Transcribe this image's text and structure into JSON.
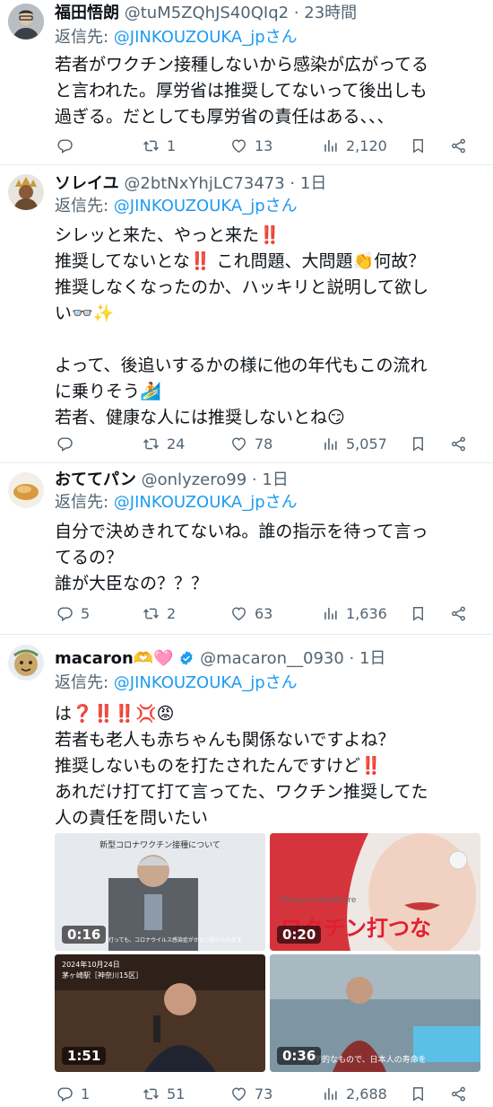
{
  "tweets": [
    {
      "name": "福田悟朗",
      "handle": "@tuM5ZQhJS40QIq2",
      "time": "23時間",
      "reply_prefix": "返信先: ",
      "reply_to": "@JINKOUZOUKA_jpさん",
      "lines": [
        "若者がワクチン接種しないから感染が広がってる",
        "と言われた。厚労省は推奨してないって後出しも",
        "過ぎる。だとしても厚労省の責任はある、、、"
      ],
      "replies": "",
      "retweets": "1",
      "likes": "13",
      "views": "2,120"
    },
    {
      "name": "ソレイユ",
      "handle": "@2btNxYhjLC73473",
      "time": "1日",
      "reply_prefix": "返信先: ",
      "reply_to": "@JINKOUZOUKA_jpさん",
      "lines": [
        "シレッと来た、やっと来た‼️",
        "推奨してないとな‼️ これ問題、大問題👏何故？",
        "推奨しなくなったのか、ハッキリと説明して欲し",
        "い👓✨",
        "",
        "よって、後追いするかの様に他の年代もこの流れ",
        "に乗りそう🏄",
        "若者、健康な人には推奨しないとね😏"
      ],
      "replies": "",
      "retweets": "24",
      "likes": "78",
      "views": "5,057"
    },
    {
      "name": "おててパン",
      "handle": "@onlyzero99",
      "time": "1日",
      "reply_prefix": "返信先: ",
      "reply_to": "@JINKOUZOUKA_jpさん",
      "lines": [
        "自分で決めきれてないね。誰の指示を待って言っ",
        "てるの？",
        "誰が大臣なの？？？"
      ],
      "replies": "5",
      "retweets": "2",
      "likes": "63",
      "views": "1,636"
    },
    {
      "name": "macaron🫶🩷",
      "handle": "@macaron__0930",
      "time": "1日",
      "reply_prefix": "返信先: ",
      "reply_to": "@JINKOUZOUKA_jpさん",
      "lines": [
        "は❓‼️‼️💢😡",
        "若者も老人も赤ちゃんも関係ないですよね？",
        "推奨しないものを打たされたんですけど‼️",
        "あれだけ打て打て言ってた、ワクチン推奨してた",
        "人の責任を問いたい"
      ],
      "replies": "1",
      "retweets": "51",
      "likes": "73",
      "views": "2,688"
    }
  ],
  "media": [
    {
      "duration": "0:16",
      "caption_top": "新型コロナワクチン接種について",
      "subtitle": "ワクチンを2回打っても、コロナウイルス感染症がかなり抑えられます"
    },
    {
      "duration": "0:20",
      "overlay_text": "ワクチン打つな",
      "tag": "#longcovidselfcare"
    },
    {
      "duration": "1:51",
      "date_text": "2024年10月24日",
      "place_text": "茅ヶ崎駅［神奈川15区］"
    },
    {
      "duration": "0:36",
      "subtitle": "科学的なもので、日本人の寿命を"
    }
  ],
  "colors": {
    "link": "#1d9bf0",
    "muted": "#536471",
    "verified": "#1d9bf0"
  },
  "icons": [
    "reply-icon",
    "retweet-icon",
    "like-icon",
    "views-icon",
    "bookmark-icon",
    "share-icon",
    "verified-icon"
  ]
}
